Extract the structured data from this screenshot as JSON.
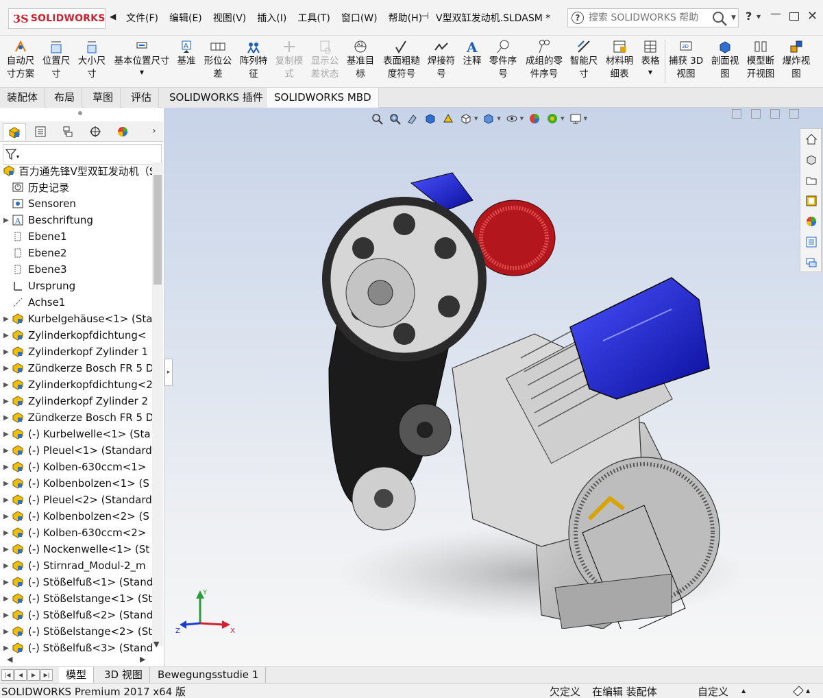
{
  "app": {
    "logo_prefix": "3S",
    "logo_text": "SOLIDWORKS",
    "document_title": "V型双缸发动机.SLDASM *",
    "menu": [
      "文件(F)",
      "编辑(E)",
      "视图(V)",
      "插入(I)",
      "工具(T)",
      "窗口(W)",
      "帮助(H)"
    ],
    "search_placeholder": "搜索 SOLIDWORKS 帮助",
    "help_label": "?"
  },
  "commands": [
    {
      "label": "自动尺\n寸方案",
      "icon": "auto-dimension-icon",
      "enabled": true
    },
    {
      "label": "位置尺\n寸",
      "icon": "location-dimension-icon",
      "enabled": true
    },
    {
      "label": "大小尺\n寸",
      "icon": "size-dimension-icon",
      "enabled": true
    },
    {
      "label": "基本位置尺寸",
      "icon": "basic-location-dimension-icon",
      "enabled": true
    },
    {
      "label": "基准",
      "icon": "datum-icon",
      "enabled": true
    },
    {
      "label": "形位公\n差",
      "icon": "geometric-tolerance-icon",
      "enabled": true
    },
    {
      "label": "阵列特\n征",
      "icon": "pattern-feature-icon",
      "enabled": true
    },
    {
      "label": "复制模\n式",
      "icon": "copy-scheme-icon",
      "enabled": false
    },
    {
      "label": "显示公\n差状态",
      "icon": "show-tolerance-status-icon",
      "enabled": false
    },
    {
      "label": "基准目\n标",
      "icon": "datum-target-icon",
      "enabled": true
    },
    {
      "label": "表面粗糙\n度符号",
      "icon": "surface-finish-icon",
      "enabled": true
    },
    {
      "label": "焊接符\n号",
      "icon": "weld-symbol-icon",
      "enabled": true
    },
    {
      "label": "注释",
      "icon": "note-icon",
      "enabled": true
    },
    {
      "label": "零件序\n号",
      "icon": "balloon-icon",
      "enabled": true
    },
    {
      "label": "成组的零\n件序号",
      "icon": "stacked-balloon-icon",
      "enabled": true
    },
    {
      "label": "智能尺\n寸",
      "icon": "smart-dimension-icon",
      "enabled": true
    },
    {
      "label": "材料明\n细表",
      "icon": "bom-icon",
      "enabled": true
    },
    {
      "label": "表格",
      "icon": "table-icon",
      "enabled": true
    },
    {
      "label": "捕获 3D\n视图",
      "icon": "capture-3d-view-icon",
      "enabled": true
    },
    {
      "label": "剖面视\n图",
      "icon": "section-view-icon",
      "enabled": true
    },
    {
      "label": "模型断\n开视图",
      "icon": "model-break-view-icon",
      "enabled": true
    },
    {
      "label": "爆炸视\n图",
      "icon": "exploded-view-icon",
      "enabled": true
    }
  ],
  "tabs": [
    "装配体",
    "布局",
    "草图",
    "评估",
    "SOLIDWORKS 插件",
    "SOLIDWORKS MBD"
  ],
  "active_tab": "SOLIDWORKS MBD",
  "tree": {
    "root": "百力通先锋V型双缸发动机（S",
    "items": [
      {
        "label": "历史记录",
        "icon": "history-icon",
        "expandable": false
      },
      {
        "label": "Sensoren",
        "icon": "sensor-icon",
        "expandable": false
      },
      {
        "label": "Beschriftung",
        "icon": "annotation-icon",
        "expandable": true
      },
      {
        "label": "Ebene1",
        "icon": "plane-icon",
        "expandable": false
      },
      {
        "label": "Ebene2",
        "icon": "plane-icon",
        "expandable": false
      },
      {
        "label": "Ebene3",
        "icon": "plane-icon",
        "expandable": false
      },
      {
        "label": "Ursprung",
        "icon": "origin-icon",
        "expandable": false
      },
      {
        "label": "Achse1",
        "icon": "axis-icon",
        "expandable": false
      },
      {
        "label": "Kurbelgehäuse<1> (Sta",
        "icon": "part-icon",
        "expandable": true
      },
      {
        "label": "Zylinderkopfdichtung<",
        "icon": "part-icon",
        "expandable": true
      },
      {
        "label": "Zylinderkopf Zylinder 1",
        "icon": "part-icon",
        "expandable": true
      },
      {
        "label": "Zündkerze Bosch FR 5 D",
        "icon": "part-icon",
        "expandable": true
      },
      {
        "label": "Zylinderkopfdichtung<2",
        "icon": "part-icon",
        "expandable": true
      },
      {
        "label": "Zylinderkopf Zylinder 2",
        "icon": "part-icon",
        "expandable": true
      },
      {
        "label": "Zündkerze Bosch FR 5 D",
        "icon": "part-icon",
        "expandable": true
      },
      {
        "label": "(-) Kurbelwelle<1> (Sta",
        "icon": "part-icon",
        "expandable": true
      },
      {
        "label": "(-) Pleuel<1> (Standard",
        "icon": "part-icon",
        "expandable": true
      },
      {
        "label": "(-) Kolben-630ccm<1>",
        "icon": "part-icon",
        "expandable": true
      },
      {
        "label": "(-) Kolbenbolzen<1> (S",
        "icon": "part-icon",
        "expandable": true
      },
      {
        "label": "(-) Pleuel<2> (Standard",
        "icon": "part-icon",
        "expandable": true
      },
      {
        "label": "(-) Kolbenbolzen<2> (S",
        "icon": "part-icon",
        "expandable": true
      },
      {
        "label": "(-) Kolben-630ccm<2>",
        "icon": "part-icon",
        "expandable": true
      },
      {
        "label": "(-) Nockenwelle<1> (St",
        "icon": "part-icon",
        "expandable": true
      },
      {
        "label": "(-) Stirnrad_Modul-2_m",
        "icon": "part-icon",
        "expandable": true
      },
      {
        "label": "(-) Stößelfuß<1> (Stand",
        "icon": "part-icon",
        "expandable": true
      },
      {
        "label": "(-) Stößelstange<1> (St",
        "icon": "part-icon",
        "expandable": true
      },
      {
        "label": "(-) Stößelfuß<2> (Stand",
        "icon": "part-icon",
        "expandable": true
      },
      {
        "label": "(-) Stößelstange<2> (St",
        "icon": "part-icon",
        "expandable": true
      },
      {
        "label": "(-) Stößelfuß<3> (Stand",
        "icon": "part-icon",
        "expandable": true
      }
    ]
  },
  "bottom_tabs": [
    "模型",
    "3D 视图",
    "Bewegungsstudie 1"
  ],
  "active_bottom_tab": "模型",
  "status": {
    "app": "SOLIDWORKS Premium 2017 x64 版",
    "definition": "欠定义",
    "editing": "在编辑 装配体",
    "units": "自定义"
  },
  "triad": {
    "x": "X",
    "y": "Y",
    "z": "Z"
  },
  "colors": {
    "accent_red": "#d3202f",
    "engine_blue": "#1a1fd8",
    "viewport_top": "#c7d3e8",
    "viewport_bottom": "#f7f7f7"
  }
}
